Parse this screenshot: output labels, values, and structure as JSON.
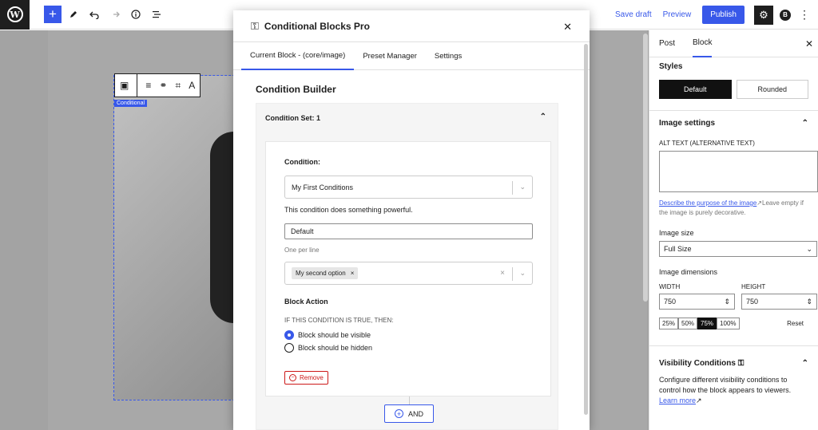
{
  "topbar": {
    "save_draft": "Save draft",
    "preview": "Preview",
    "publish": "Publish"
  },
  "canvas": {
    "block_label": "Conditional"
  },
  "sidebar": {
    "tabs": [
      "Post",
      "Block"
    ],
    "styles_heading": "Styles",
    "style_default": "Default",
    "style_rounded": "Rounded",
    "image_settings_heading": "Image settings",
    "alt_label": "ALT TEXT (ALTERNATIVE TEXT)",
    "alt_help_link": "Describe the purpose of the image",
    "alt_help_text": "Leave empty if the image is purely decorative.",
    "image_size_label": "Image size",
    "image_size_value": "Full Size",
    "dimensions_label": "Image dimensions",
    "width_label": "WIDTH",
    "width_value": "750",
    "height_label": "HEIGHT",
    "height_value": "750",
    "pct_options": [
      "25%",
      "50%",
      "75%",
      "100%"
    ],
    "pct_selected": "75%",
    "reset": "Reset",
    "visibility_heading": "Visibility Conditions",
    "visibility_text": "Configure different visibility conditions to control how the block appears to viewers.",
    "learn_more": "Learn more"
  },
  "modal": {
    "title": "Conditional Blocks Pro",
    "tabs": [
      "Current Block - (core/image)",
      "Preset Manager",
      "Settings"
    ],
    "builder_title": "Condition Builder",
    "condition_set": "Condition Set: 1",
    "condition_label": "Condition:",
    "condition_value": "My First Conditions",
    "condition_desc": "This condition does something powerful.",
    "text_value": "Default",
    "one_per_line": "One per line",
    "tag_value": "My second option",
    "block_action": "Block Action",
    "if_true": "IF THIS CONDITION IS TRUE, THEN:",
    "radio_visible": "Block should be visible",
    "radio_hidden": "Block should be hidden",
    "remove": "Remove",
    "and": "AND"
  },
  "colors": {
    "accent": "#3858e9",
    "danger": "#cc1818",
    "dark": "#1e1e1e"
  }
}
